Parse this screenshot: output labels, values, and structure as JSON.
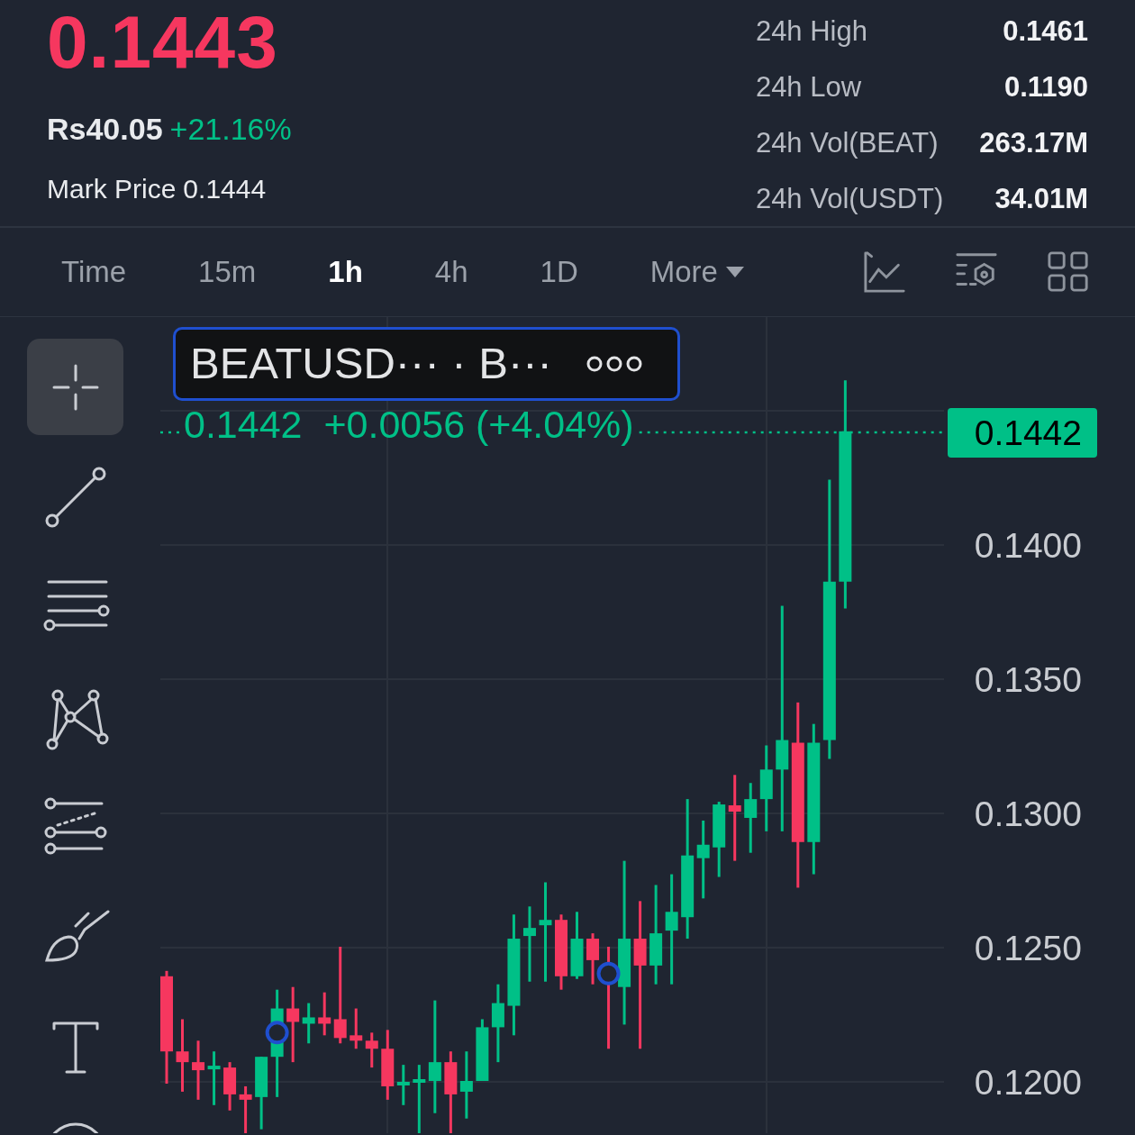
{
  "header": {
    "price": "0.1443",
    "fiat_price": "Rs40.05",
    "change": "+21.16%",
    "mark_price_label": "Mark Price",
    "mark_price": "0.1444",
    "stats": [
      {
        "label": "24h High",
        "value": "0.1461"
      },
      {
        "label": "24h Low",
        "value": "0.1190"
      },
      {
        "label": "24h Vol(BEAT)",
        "value": "263.17M"
      },
      {
        "label": "24h Vol(USDT)",
        "value": "34.01M"
      }
    ]
  },
  "intervals": [
    {
      "label": "Time",
      "selected": false
    },
    {
      "label": "15m",
      "selected": false
    },
    {
      "label": "1h",
      "selected": true
    },
    {
      "label": "4h",
      "selected": false
    },
    {
      "label": "1D",
      "selected": false
    },
    {
      "label": "More",
      "selected": false,
      "dropdown": true
    }
  ],
  "tools": [
    {
      "kind": "crosshair",
      "selected": true
    },
    {
      "kind": "trend-line",
      "selected": false
    },
    {
      "kind": "parallel-lines",
      "selected": false
    },
    {
      "kind": "pattern",
      "selected": false
    },
    {
      "kind": "fib",
      "selected": false
    },
    {
      "kind": "brush",
      "selected": false
    },
    {
      "kind": "text",
      "selected": false
    },
    {
      "kind": "shape",
      "selected": false
    }
  ],
  "chart": {
    "symbol": "BEATUSD··· · B···",
    "legend": "0.1442  +0.0056 (+4.04%)",
    "last_price": "0.1442",
    "price_axis": [
      "0.1400",
      "0.1350",
      "0.1300",
      "0.1250",
      "0.1200"
    ]
  }
}
